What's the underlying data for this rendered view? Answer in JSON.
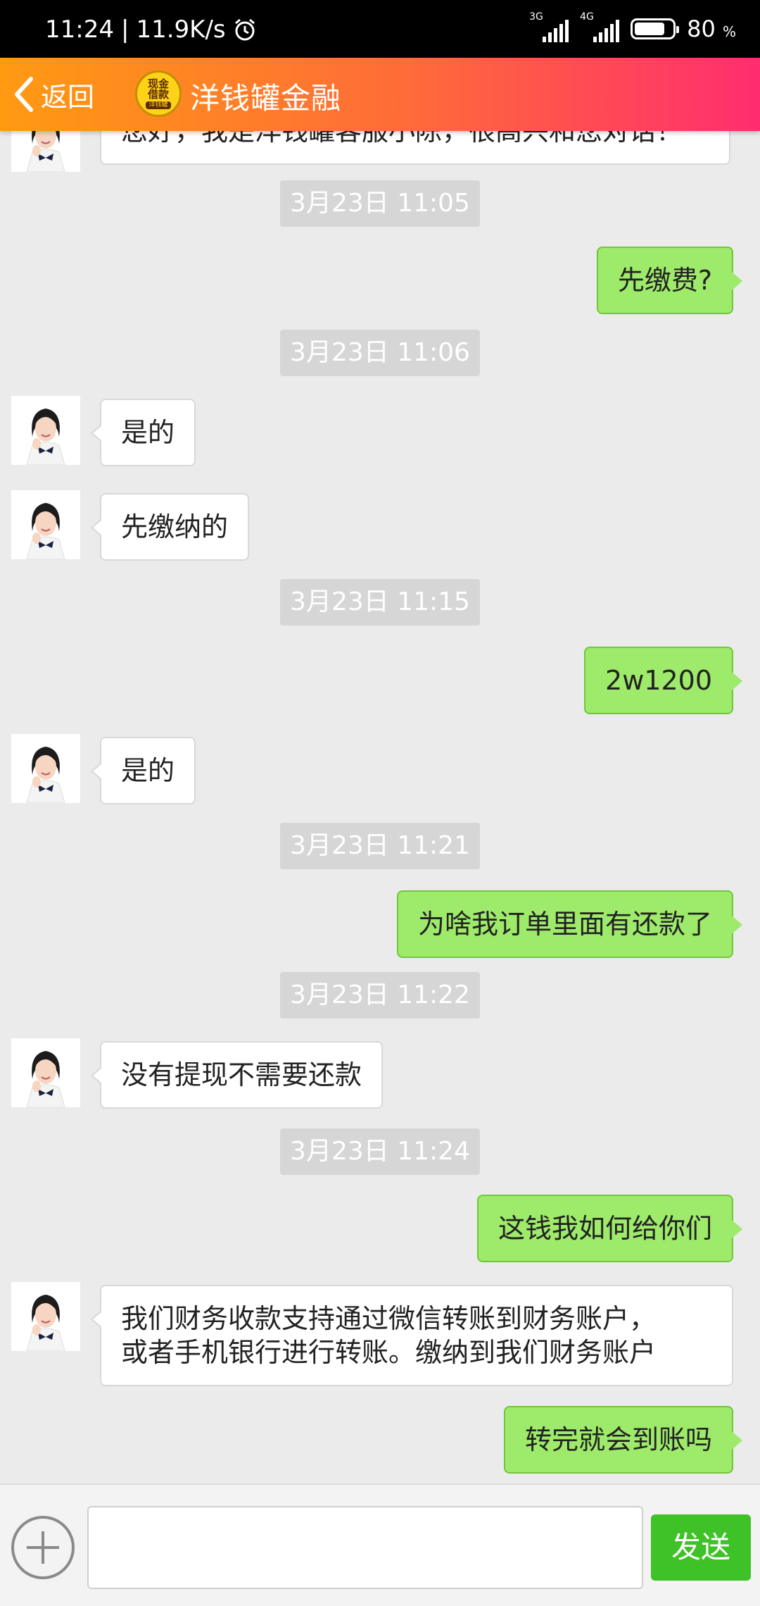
{
  "status_bar": {
    "time": "11:24",
    "speed": "11.9K/s",
    "signal1_tag": "3G",
    "signal2_tag": "4G",
    "battery_percent": "80",
    "battery_unit": "%",
    "battery_level": 0.8
  },
  "header": {
    "back_label": "返回",
    "logo_line1": "现金",
    "logo_line2": "借款",
    "logo_sub": "洋钱罐",
    "title": "洋钱罐金融"
  },
  "messages": {
    "m0": "您好，我是洋钱罐客服小陈，很高兴和您对话！",
    "t1": "3月23日 11:05",
    "m1": "先缴费?",
    "t2": "3月23日 11:06",
    "m2": "是的",
    "m3": "先缴纳的",
    "t3": "3月23日 11:15",
    "m4": "2w1200",
    "m5": "是的",
    "t4": "3月23日 11:21",
    "m6": "为啥我订单里面有还款了",
    "t5": "3月23日 11:22",
    "m7": "没有提现不需要还款",
    "t6": "3月23日 11:24",
    "m8": "这钱我如何给你们",
    "m9_line1": "我们财务收款支持通过微信转账到财务账户，",
    "m9_line2": "或者手机银行进行转账。缴纳到我们财务账户",
    "m10": "转完就会到账吗"
  },
  "input_bar": {
    "input_value": "",
    "send_label": "发送"
  },
  "colors": {
    "header_start": "#ff9a12",
    "header_end": "#ff2d6f",
    "bubble_self": "#9eea6a",
    "send_button": "#3ec227"
  }
}
